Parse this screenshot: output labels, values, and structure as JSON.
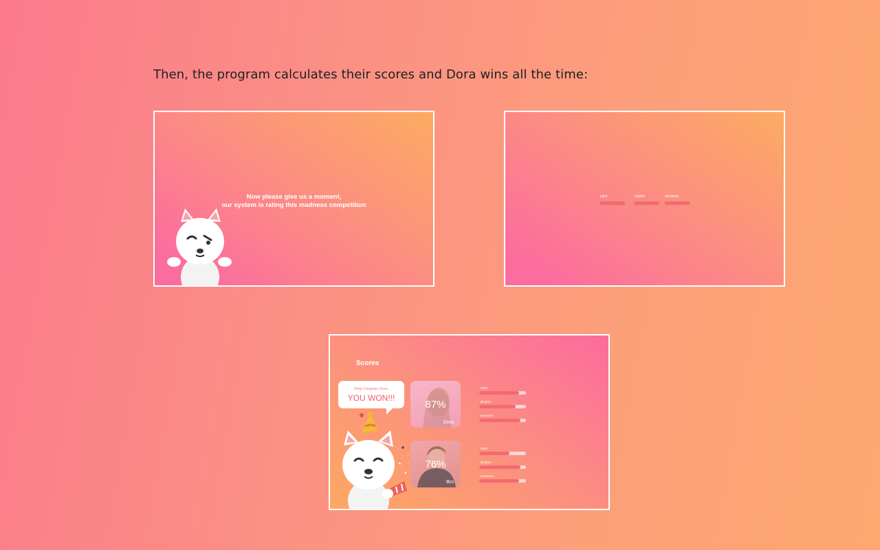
{
  "intro_text": "Then, the program calculates their scores and Dora wins all the time:",
  "slide_rating": {
    "line1": "Now please give us a moment,",
    "line2": "our system is rating this madness competition"
  },
  "slide_metrics": {
    "labels": [
      "pitch",
      "rhythm",
      "emotions"
    ]
  },
  "slide_scores": {
    "title": "Scores",
    "bubble_small": "Omg Congrats Dora,",
    "bubble_big": "YOU WON!!!",
    "players": [
      {
        "name": "Dora",
        "percent": "87%",
        "bars": [
          {
            "label": "Pitch",
            "fill": 0.85
          },
          {
            "label": "Rhythm",
            "fill": 0.78
          },
          {
            "label": "Emotions",
            "fill": 0.88
          }
        ]
      },
      {
        "name": "Bro",
        "percent": "76%",
        "bars": [
          {
            "label": "Pitch",
            "fill": 0.65
          },
          {
            "label": "Rhythm",
            "fill": 0.88
          },
          {
            "label": "Emotions",
            "fill": 0.85
          }
        ]
      }
    ]
  },
  "colors": {
    "accent_bar": "#f36a6f",
    "bar_track": "#fbd8d8",
    "bubble_text": "#f15a6c"
  },
  "icons": [
    "dog-mascot-icon",
    "party-hat-icon",
    "party-horn-icon",
    "confetti-icon"
  ]
}
